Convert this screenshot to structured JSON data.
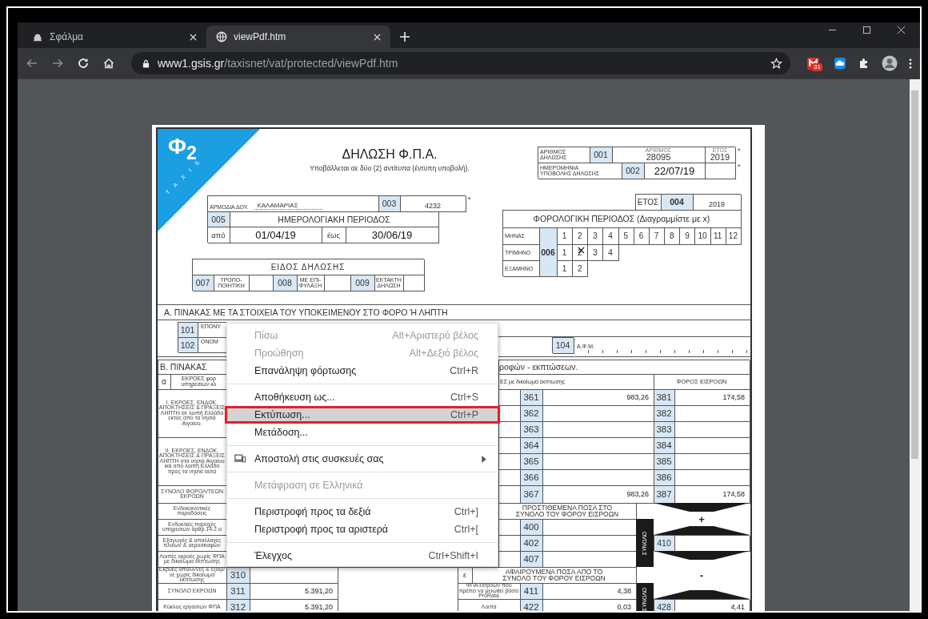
{
  "browser": {
    "tabs": [
      {
        "title": "Σφάλμα",
        "selected": false
      },
      {
        "title": "viewPdf.htm",
        "selected": true
      }
    ],
    "url": {
      "host": "www1.gsis.gr",
      "path": "/taxisnet/vat/protected/viewPdf.htm"
    },
    "calendar_badge": "31"
  },
  "form": {
    "logo": {
      "mark": "Φ$_{2}$",
      "brand": "TAXIS"
    },
    "title": "ΔΗΛΩΣΗ Φ.Π.Α.",
    "subtitle": "Υποβάλλεται σε δύο (2) αντίτυπα (έντυπη υποβολή).",
    "office": {
      "label": "ΑΡΜΟΔΙΑ ΔΟΥ.",
      "value": "ΚΑΛΑΜΑΡΙΑΣ",
      "code": "003",
      "code_value": "4232",
      "note": "*"
    },
    "calendar_period": {
      "code": "005",
      "title": "ΗΜΕΡΟΛΟΓΙΑΚΗ ΠΕΡΙΟΔΟΣ",
      "from_label": "από",
      "from": "01/04/19",
      "to_label": "έως",
      "to": "30/06/19"
    },
    "declaration_type": {
      "title": "ΕΙΔΟΣ ΔΗΛΩΣΗΣ",
      "options": [
        {
          "code": "007",
          "label": "ΤΡΟΠΟ-\nΠΟΙΗΤΙΚΗ",
          "checked": false
        },
        {
          "code": "008",
          "label": "ΜΕ ΕΠΙ-\nΦΥΛΑΞΗ",
          "checked": false
        },
        {
          "code": "009",
          "label": "ΕΚΤΑΚΤΗ\nΔΗΛΩΣΗ",
          "checked": false
        }
      ]
    },
    "declaration_number": {
      "label": "ΑΡΙΘΜΟΣ\nΔΗΛΩΣΗΣ",
      "code": "001",
      "number_caption": "ΑΡΙΘΜΟΣ",
      "number": "28095",
      "year_caption": "ΕΤΟΣ",
      "year": "2019",
      "note": "*"
    },
    "submission_date": {
      "label": "ΗΜΕΡΟΜΗΝΙΑ\nΥΠΟΒΟΛΗΣ ΔΗΛΩΣΗΣ",
      "code": "002",
      "value": "22/07/19",
      "note": "*"
    },
    "year": {
      "label": "ΕΤΟΣ",
      "code": "004",
      "value": "2019"
    },
    "tax_period": {
      "title": "ΦΟΡΟΛΟΓΙΚΗ ΠΕΡΙΟΔΟΣ (Διαγραμμίστε με x)",
      "code": "006",
      "rows": [
        {
          "label": "ΜΗΝΑΣ",
          "cells": [
            {
              "number": "1",
              "marked": false
            },
            {
              "number": "2",
              "marked": false
            },
            {
              "number": "3",
              "marked": false
            },
            {
              "number": "4",
              "marked": false
            },
            {
              "number": "5",
              "marked": false
            },
            {
              "number": "6",
              "marked": false
            },
            {
              "number": "7",
              "marked": false
            },
            {
              "number": "8",
              "marked": false
            },
            {
              "number": "9",
              "marked": false
            },
            {
              "number": "10",
              "marked": false
            },
            {
              "number": "11",
              "marked": false
            },
            {
              "number": "12",
              "marked": false
            }
          ]
        },
        {
          "label": "ΤΡΙΜΗΝΟ",
          "cells": [
            {
              "number": "1",
              "marked": false
            },
            {
              "number": "2",
              "marked": true
            },
            {
              "number": "3",
              "marked": false
            },
            {
              "number": "4",
              "marked": false
            }
          ]
        },
        {
          "label": "ΕΞΑΜΗΝΟ",
          "cells": [
            {
              "number": "1",
              "marked": false
            },
            {
              "number": "2",
              "marked": false
            }
          ]
        }
      ]
    },
    "section_a": {
      "title": "Α. ΠΙΝΑΚΑΣ ΜΕ ΤΑ ΣΤΟΙΧΕΙΑ ΤΟΥ ΥΠΟΚΕΙΜΕΝΟΥ ΣΤΟ ΦΟΡΟ Ή ΛΗΠΤΗ",
      "fields": [
        {
          "code": "101",
          "label": "ΕΠΟΝΥ"
        },
        {
          "code": "102",
          "label": "ΟΝΟΜ"
        }
      ],
      "tin": {
        "code": "104",
        "label": "Α.Φ.Μ."
      }
    },
    "section_b": {
      "title": "Β. ΠΙΝΑΚΑΣ",
      "title_tail": "ροφών - εκπτώσεων.",
      "column_letter": "α",
      "outputs_heading": "ΕΚΡΟΕΣ φορ\nυπηρεσιών κλ",
      "inputs_heading": "ΕΣ με δικαίωμα έκπτωσης",
      "tax_heading": "ΦΟΡΟΣ ΕΙΣΡΟΩΝ",
      "output_groups": [
        "I. ΕΚΡΟΕΣ, ΕΝΔΟΚ. ΑΠΟΚΤΗΣΕΙΣ & ΠΡΑΞΕΙΣ ΛΗΠΤΗ σε λοιπή Ελλάδα εκτός από τα νησιά Αιγαίου.",
        "II. ΕΚΡΟΕΣ, ΕΝΔΟΚ. ΑΠΟΚΤΗΣΕΙΣ & ΠΡΑΞΕΙΣ ΛΗΠΤΗ στα νησιά Αιγαίου και από λοιπή Ελλάδα προς τα νησιά αυτά",
        "ΣΥΝΟΛΟ ΦΟΡΟΛ/ΤΕΩΝ ΕΚΡΟΩΝ"
      ],
      "output_rows": [
        {
          "label": "Ενδοκοινοτικές παραδόσεις"
        },
        {
          "label": "Ενδοκ/κές παροχές υπηρεσιών άρθρ.14.2.α"
        },
        {
          "label": "Εξαγωγές & απαλλαγές πλοίων & αεροσκαφών"
        },
        {
          "label": "Λοιπές εκροές χωρίς ΦΠΑ με δικαίωμα έκπτωσης"
        },
        {
          "label": "Εκροές απαλλ/νες & εξαιρ/νε χωρίς δικαίωμα έκπτωσης",
          "code": "310"
        },
        {
          "label": "ΣΥΝΟΛΟ ΕΚΡΟΩΝ",
          "code": "311",
          "value": "5.391,20"
        },
        {
          "label": "Κύκλος εργασιών ΦΠΑ",
          "code": "312",
          "value": "5.391,20"
        }
      ],
      "input_rows": [
        {
          "code": "361",
          "value": "983,26",
          "tax_code": "381",
          "tax_value": "174,58"
        },
        {
          "code": "362",
          "tax_code": "382"
        },
        {
          "code": "363",
          "tax_code": "383"
        },
        {
          "code": "364",
          "tax_code": "384"
        },
        {
          "code": "365",
          "tax_code": "385"
        },
        {
          "code": "366",
          "tax_code": "386"
        },
        {
          "code": "367",
          "value": "983,26",
          "tax_code": "387",
          "tax_value": "174,58"
        }
      ],
      "added": {
        "title": "ΠΡΟΣΤΙΘΕΜΕΝΑ ΠΟΣΑ ΣΤΟ\nΣΥΝΟΛΟ ΤΟΥ ΦΟΡΟΥ ΕΙΣΡΟΩΝ",
        "rows": [
          {
            "code": "400"
          },
          {
            "code": "402"
          },
          {
            "code": "407"
          }
        ],
        "sign": "+",
        "total_label": "ΣΥΝΟΛΟ",
        "total_code": "410"
      },
      "subtracted": {
        "letter": "ε",
        "title": "ΑΦΑΙΡΟΥΜΕΝΑ ΠΟΣΑ ΑΠΟ ΤΟ\nΣΥΝΟΛΟ ΤΟΥ ΦΟΡΟΥ ΕΙΣΡΟΩΝ",
        "rows": [
          {
            "label": "ΦΠΑ εισροών που πρέπει να μειωθεί βάσει ProRata",
            "code": "411",
            "value": "4,38"
          },
          {
            "label": "Λοιπά",
            "code": "422",
            "value": "0,03"
          }
        ],
        "sign": "-",
        "total_label": "ΣΥΝΟΛΟ",
        "total_code": "428",
        "total_value": "4,41"
      }
    }
  },
  "context_menu": {
    "items": [
      {
        "kind": "item",
        "label": "Πίσω",
        "shortcut": "Alt+Αριστερό βέλος",
        "disabled": true,
        "selected": false
      },
      {
        "kind": "item",
        "label": "Προώθηση",
        "shortcut": "Alt+Δεξιό βέλος",
        "disabled": true,
        "selected": false
      },
      {
        "kind": "item",
        "label": "Επανάληψη φόρτωσης",
        "shortcut": "Ctrl+R",
        "disabled": false,
        "selected": false
      },
      {
        "kind": "separator"
      },
      {
        "kind": "item",
        "label": "Αποθήκευση ως...",
        "shortcut": "Ctrl+S",
        "disabled": false,
        "selected": false
      },
      {
        "kind": "item",
        "label": "Εκτύπωση...",
        "shortcut": "Ctrl+P",
        "disabled": false,
        "selected": true
      },
      {
        "kind": "item",
        "label": "Μετάδοση...",
        "disabled": false,
        "selected": false
      },
      {
        "kind": "separator"
      },
      {
        "kind": "submenu",
        "label": "Αποστολή στις συσκευές σας",
        "disabled": false,
        "selected": false
      },
      {
        "kind": "separator"
      },
      {
        "kind": "item",
        "label": "Μετάφραση σε Ελληνικά",
        "disabled": true,
        "selected": false
      },
      {
        "kind": "separator"
      },
      {
        "kind": "item",
        "label": "Περιστροφή προς τα δεξιά",
        "shortcut": "Ctrl+]",
        "disabled": false,
        "selected": false
      },
      {
        "kind": "item",
        "label": "Περιστροφή προς τα αριστερά",
        "shortcut": "Ctrl+[",
        "disabled": false,
        "selected": false
      },
      {
        "kind": "separator"
      },
      {
        "kind": "item",
        "label": "Έλεγχος",
        "shortcut": "Ctrl+Shift+I",
        "disabled": false,
        "selected": false
      }
    ]
  }
}
